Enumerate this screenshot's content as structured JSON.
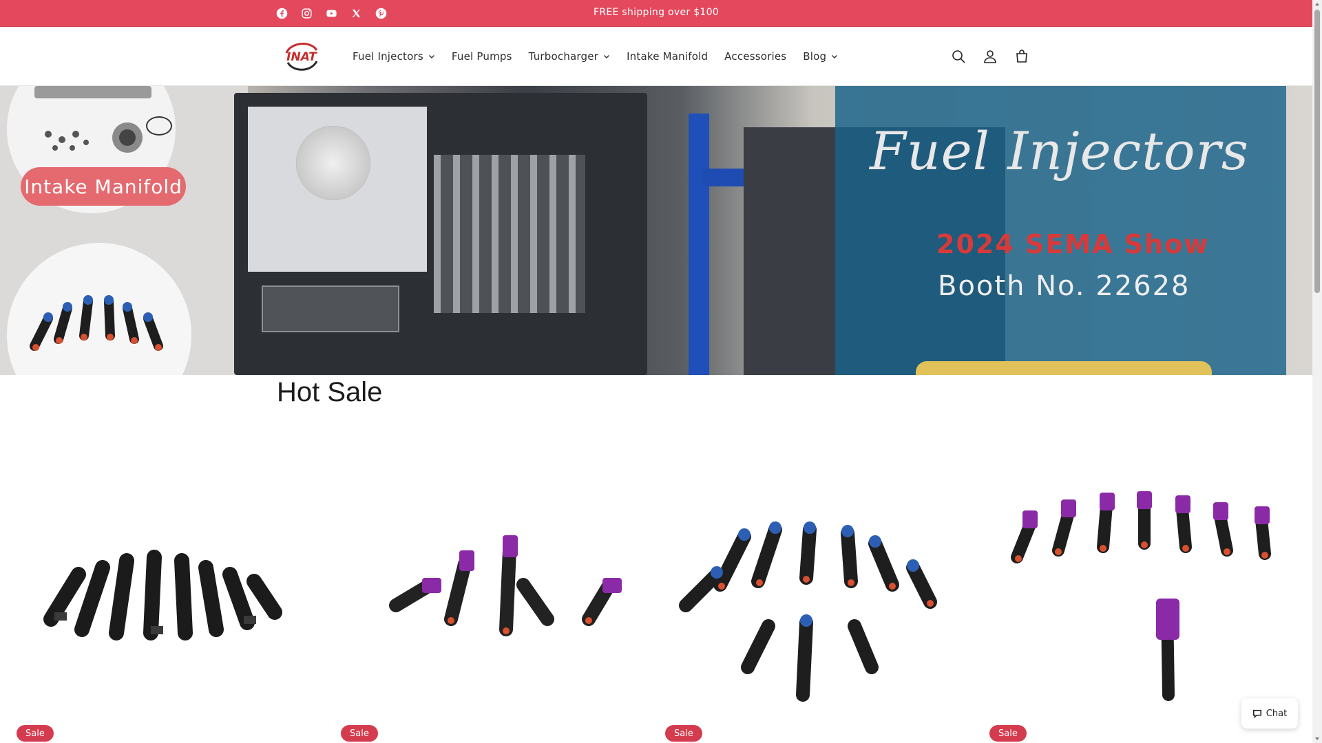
{
  "announcement": {
    "text": "FREE shipping over $100",
    "socials": [
      "facebook-icon",
      "instagram-icon",
      "youtube-icon",
      "x-icon",
      "pinterest-icon"
    ]
  },
  "header": {
    "logo_text": "INAT",
    "nav": [
      {
        "label": "Fuel Injectors",
        "dropdown": true
      },
      {
        "label": "Fuel Pumps",
        "dropdown": false
      },
      {
        "label": "Turbocharger",
        "dropdown": true
      },
      {
        "label": "Intake Manifold",
        "dropdown": false
      },
      {
        "label": "Accessories",
        "dropdown": false
      },
      {
        "label": "Blog",
        "dropdown": true
      }
    ],
    "icons": [
      "search-icon",
      "account-icon",
      "cart-icon"
    ]
  },
  "hero": {
    "badge": "Intake Manifold",
    "title": "Fuel Injectors",
    "event": "2024 SEMA Show",
    "booth": "Booth No. 22628"
  },
  "section": {
    "title": "Hot Sale"
  },
  "products": [
    {
      "badge": "Sale"
    },
    {
      "badge": "Sale"
    },
    {
      "badge": "Sale"
    },
    {
      "badge": "Sale"
    }
  ],
  "chat": {
    "label": "Chat"
  },
  "colors": {
    "announcement_bg": "#e4485d",
    "sale_badge": "#d43b4e",
    "hero_overlay": "#186289"
  }
}
